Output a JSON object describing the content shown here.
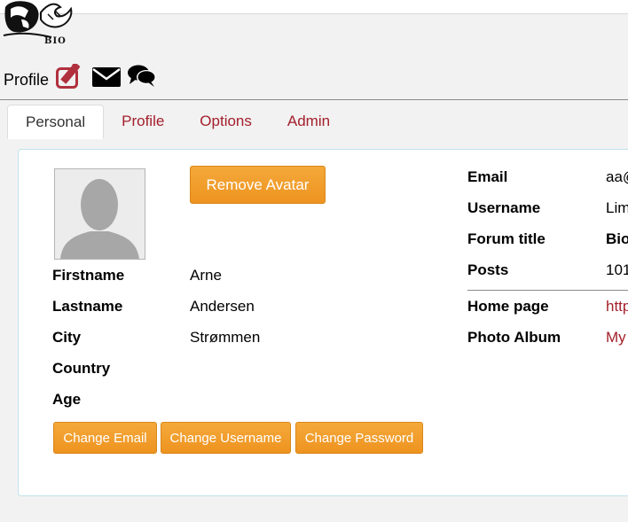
{
  "logo": {
    "text": "BIO",
    "icon": "bio-logo"
  },
  "header": {
    "title": "Profile",
    "icons": [
      "edit-icon",
      "envelope-icon",
      "chat-icon"
    ]
  },
  "tabs": [
    {
      "label": "Personal",
      "active": true
    },
    {
      "label": "Profile",
      "active": false
    },
    {
      "label": "Options",
      "active": false
    },
    {
      "label": "Admin",
      "active": false
    }
  ],
  "avatar": {
    "remove_label": "Remove Avatar"
  },
  "personal": {
    "firstname_label": "Firstname",
    "firstname_value": "Arne",
    "lastname_label": "Lastname",
    "lastname_value": "Andersen",
    "city_label": "City",
    "city_value": "Strømmen",
    "country_label": "Country",
    "country_value": "",
    "age_label": "Age",
    "age_value": ""
  },
  "buttons": {
    "change_email": "Change Email",
    "change_username": "Change Username",
    "change_password": "Change Password"
  },
  "account": {
    "email_label": "Email",
    "email_value": "aa@",
    "username_label": "Username",
    "username_value": "Lim",
    "forum_title_label": "Forum title",
    "forum_title_value": "Bio",
    "posts_label": "Posts",
    "posts_value": "101",
    "homepage_label": "Home page",
    "homepage_value": "http",
    "album_label": "Photo Album",
    "album_value": "My"
  },
  "colors": {
    "accent_orange": "#f19c27",
    "link_red": "#a3202c",
    "panel_border": "#bfe3ea"
  }
}
